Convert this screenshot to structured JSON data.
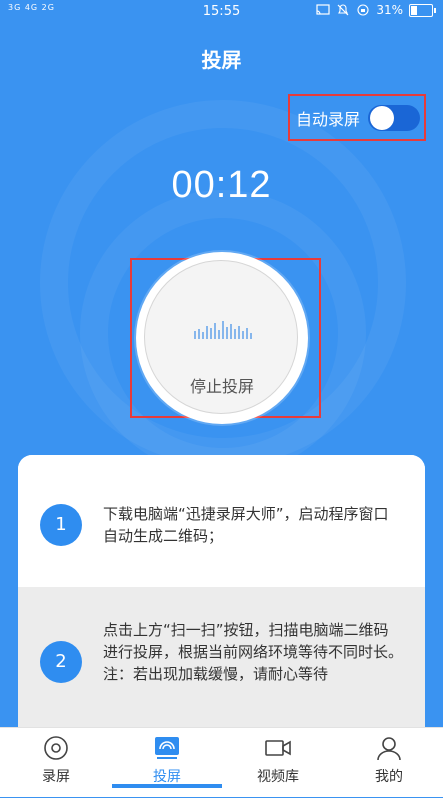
{
  "status_bar": {
    "signal": "3G 4G 2G",
    "time": "15:55",
    "battery": "31%",
    "battery_level": 0.31,
    "icons": [
      "cast-icon",
      "mute-icon",
      "lock-rotation-icon",
      "battery-icon"
    ]
  },
  "header": {
    "title": "投屏"
  },
  "auto_record": {
    "label": "自动录屏",
    "enabled": true
  },
  "timer": {
    "value": "00:12"
  },
  "stop_button": {
    "label": "停止投屏"
  },
  "steps": [
    {
      "number": "1",
      "text": "下载电脑端“迅捷录屏大师”，启动程序窗口自动生成二维码；"
    },
    {
      "number": "2",
      "text": "点击上方“扫一扫”按钮，扫描电脑端二维码进行投屏，根据当前网络环境等待不同时长。 注：若出现加载缓慢，请耐心等待"
    }
  ],
  "tabs": [
    {
      "label": "录屏",
      "icon": "record-icon",
      "active": false
    },
    {
      "label": "投屏",
      "icon": "cast-screen-icon",
      "active": true
    },
    {
      "label": "视频库",
      "icon": "video-library-icon",
      "active": false
    },
    {
      "label": "我的",
      "icon": "profile-icon",
      "active": false
    }
  ],
  "colors": {
    "background": "#3a93f1",
    "accent": "#2f8df0",
    "highlight_border": "#e83b3b",
    "toggle_on": "#1a66d6"
  }
}
